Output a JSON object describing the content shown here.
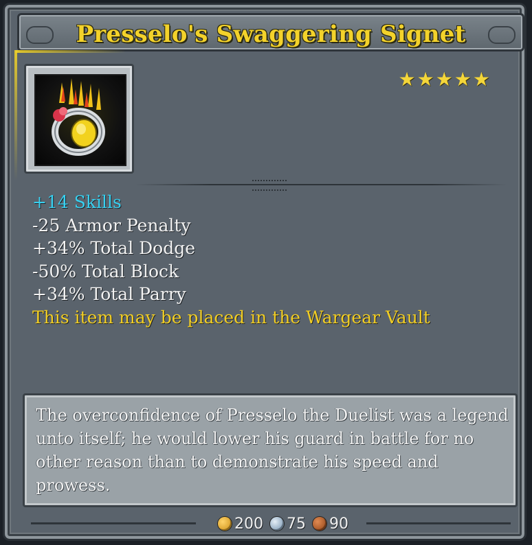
{
  "item": {
    "name": "Presselo's Swaggering Signet",
    "rating": {
      "stars": "★★★★★",
      "value": 5,
      "max": 5
    },
    "icon": "flaming-signet-ring-icon"
  },
  "stats": [
    "+14 Skills",
    "-25 Armor Penalty",
    "+34% Total Dodge",
    "-50% Total Block",
    "+34% Total Parry",
    "This item may be placed in the Wargear Vault"
  ],
  "lore": "The overconfidence of Presselo the Duelist was a legend unto itself; he would lower his guard in battle for no other reason than to demonstrate his speed and prowess.",
  "cost": {
    "gold": "200",
    "silver": "75",
    "bronze": "90"
  },
  "colors": {
    "title": "#f3d22b",
    "skills": "#38d0f0",
    "vault_note": "#f2ce24",
    "stat_text": "#f2f2f2",
    "panel": "#5a636c"
  }
}
